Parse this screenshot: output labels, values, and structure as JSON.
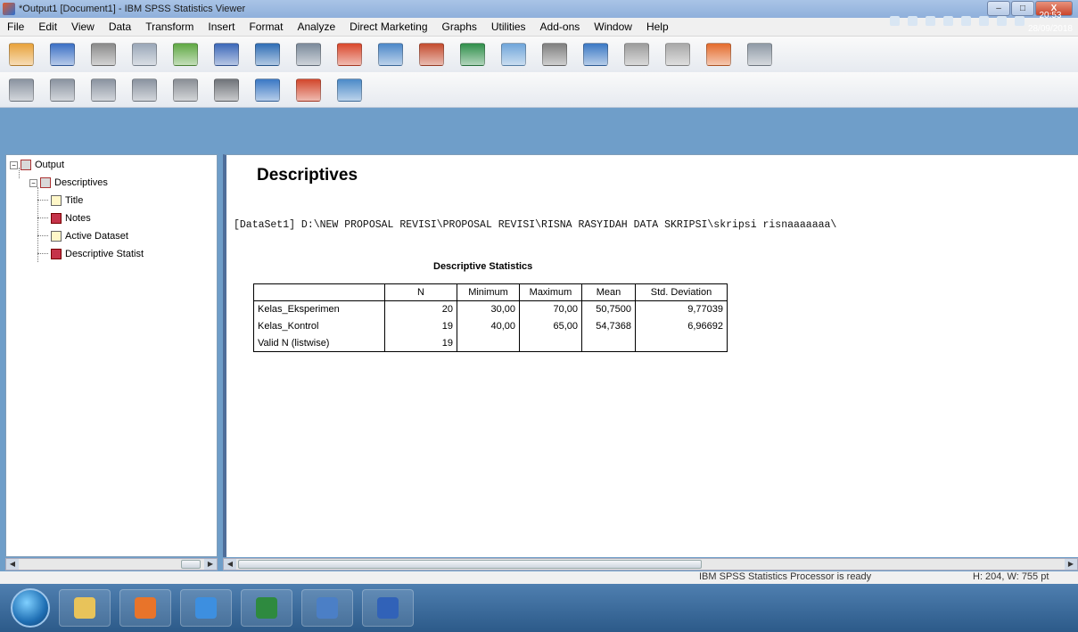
{
  "window": {
    "title": "*Output1 [Document1] - IBM SPSS Statistics Viewer",
    "controls": {
      "minimize": "–",
      "maximize": "□",
      "close": "X"
    }
  },
  "menu": [
    "File",
    "Edit",
    "View",
    "Data",
    "Transform",
    "Insert",
    "Format",
    "Analyze",
    "Direct Marketing",
    "Graphs",
    "Utilities",
    "Add-ons",
    "Window",
    "Help"
  ],
  "toolbar1": [
    {
      "name": "open-icon",
      "color": "#e8a23a"
    },
    {
      "name": "save-icon",
      "color": "#3a6fc4"
    },
    {
      "name": "print-icon",
      "color": "#8a8a8a"
    },
    {
      "name": "print-preview-icon",
      "color": "#9aa7b8"
    },
    {
      "name": "export-icon",
      "color": "#5fa843"
    },
    {
      "name": "recall-dialog-icon",
      "color": "#3b67b8"
    },
    {
      "name": "undo-icon",
      "color": "#2e6db5"
    },
    {
      "name": "redo-icon",
      "color": "#7b8a9b"
    },
    {
      "name": "goto-case-icon",
      "color": "#d9472c"
    },
    {
      "name": "goto-variable-icon",
      "color": "#4b87c8"
    },
    {
      "name": "variables-icon",
      "color": "#c44b2e"
    },
    {
      "name": "create-table-icon",
      "color": "#2f8f4a"
    },
    {
      "name": "show-all-variables-icon",
      "color": "#6fa5d9"
    },
    {
      "name": "spell-check-icon",
      "color": "#7f7f7f"
    },
    {
      "name": "designate-window-icon",
      "color": "#3a78c4"
    },
    {
      "name": "insert-title-icon",
      "color": "#9c9c9c"
    },
    {
      "name": "insert-text-icon",
      "color": "#a8a8a8"
    },
    {
      "name": "insert-chart-icon",
      "color": "#e46b2c"
    },
    {
      "name": "insert-image-icon",
      "color": "#8f9aa6"
    }
  ],
  "toolbar2": [
    {
      "name": "promote-icon",
      "color": "#8a93a0"
    },
    {
      "name": "demote-icon",
      "color": "#8a93a0"
    },
    {
      "name": "expand-icon",
      "color": "#8a93a0"
    },
    {
      "name": "collapse-icon",
      "color": "#8a93a0"
    },
    {
      "name": "show-icon",
      "color": "#8a8f96"
    },
    {
      "name": "hide-icon",
      "color": "#6f7379"
    },
    {
      "name": "insert-heading-icon",
      "color": "#3a78c4"
    },
    {
      "name": "insert-new-title-icon",
      "color": "#d2462b"
    },
    {
      "name": "insert-new-text-icon",
      "color": "#4b8ac8"
    }
  ],
  "outline": {
    "root": "Output",
    "child": "Descriptives",
    "leaves": [
      "Title",
      "Notes",
      "Active Dataset",
      "Descriptive Statist"
    ]
  },
  "content": {
    "heading": "Descriptives",
    "dataset_line": "[DataSet1] D:\\NEW PROPOSAL REVISI\\PROPOSAL REVISI\\RISNA RASYIDAH DATA SKRIPSI\\skripsi risnaaaaaaa\\",
    "table_title": "Descriptive Statistics",
    "table": {
      "headers": [
        "",
        "N",
        "Minimum",
        "Maximum",
        "Mean",
        "Std. Deviation"
      ],
      "rows": [
        {
          "label": "Kelas_Eksperimen",
          "n": "20",
          "min": "30,00",
          "max": "70,00",
          "mean": "50,7500",
          "sd": "9,77039"
        },
        {
          "label": "Kelas_Kontrol",
          "n": "19",
          "min": "40,00",
          "max": "65,00",
          "mean": "54,7368",
          "sd": "6,96692"
        },
        {
          "label": "Valid N (listwise)",
          "n": "19",
          "min": "",
          "max": "",
          "mean": "",
          "sd": ""
        }
      ]
    }
  },
  "status": {
    "processor": "IBM SPSS Statistics Processor is ready",
    "dims": "H: 204, W: 755 pt"
  },
  "taskbar": {
    "apps": [
      {
        "name": "explorer-taskbar-icon",
        "color": "#e8c35a"
      },
      {
        "name": "media-player-taskbar-icon",
        "color": "#e8742a"
      },
      {
        "name": "internet-explorer-taskbar-icon",
        "color": "#3d8fe0"
      },
      {
        "name": "excel-taskbar-icon",
        "color": "#2e8a3f"
      },
      {
        "name": "spss-taskbar-icon",
        "color": "#4b7fc6"
      },
      {
        "name": "word-taskbar-icon",
        "color": "#3162b8"
      }
    ],
    "time": "20:53",
    "date": "28/09/2018"
  }
}
